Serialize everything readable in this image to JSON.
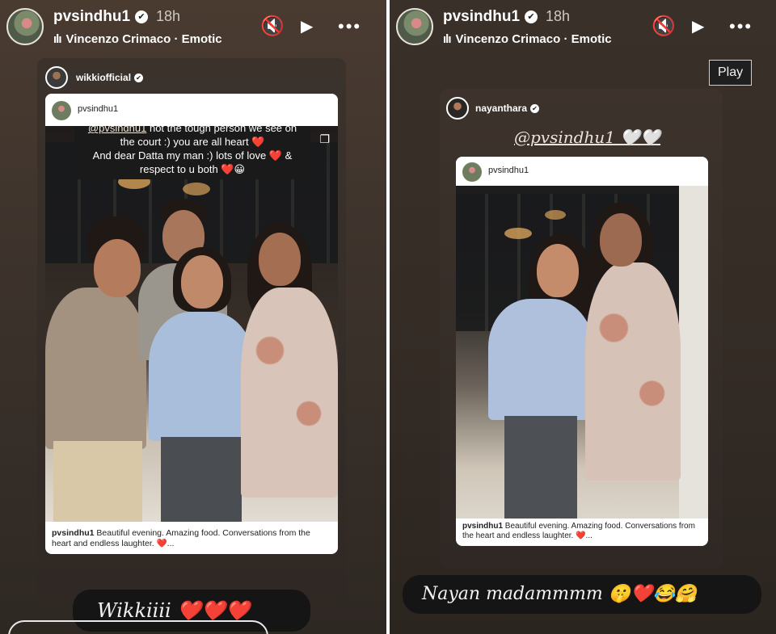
{
  "left_story": {
    "username": "pvsindhu1",
    "time": "18h",
    "music": "Vincenzo Crimaco · Emotic",
    "post_author": "wikkiofficial",
    "inner_post_author": "pvsindhu1",
    "comment": {
      "mention": "@pvsindhu1",
      "line1_rest": " not the tough person we see on",
      "line2": "the court :) you are all heart ❤️",
      "line3": "And dear Datta my man :) lots of love ❤️ &",
      "line4": "respect to u both ❤️😀"
    },
    "caption_user": "pvsindhu1",
    "caption_text": " Beautiful evening. Amazing food. Conversations from the heart and endless laughter. ❤️...",
    "reply_text": "Wikkiiii ❤️❤️❤️"
  },
  "right_story": {
    "username": "pvsindhu1",
    "time": "18h",
    "music": "Vincenzo Crimaco · Emotic",
    "tooltip": "Play",
    "post_author": "nayanthara",
    "handwritten_text": "@pvsindhu1 🤍🤍",
    "inner_post_author": "pvsindhu1",
    "caption_user": "pvsindhu1",
    "caption_text": " Beautiful evening. Amazing food. Conversations from the heart and endless laughter. ❤️...",
    "reply_text": "Nayan madammmm 🤫❤️😂🤗"
  },
  "icons": {
    "verified": "✔",
    "music": "ılı",
    "mute": "🔇",
    "play": "▶",
    "more": "•••",
    "copy": "❐"
  }
}
